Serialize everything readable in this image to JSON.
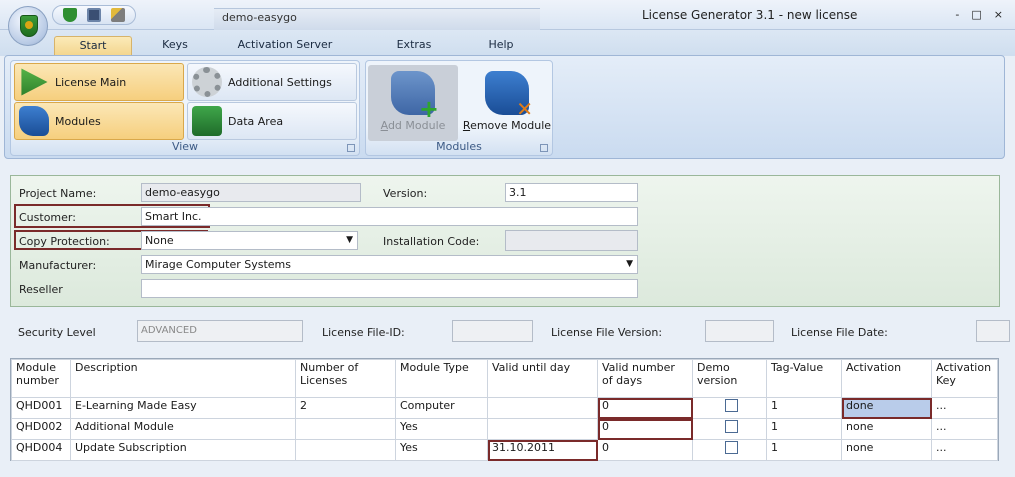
{
  "window": {
    "title": "License Generator 3.1 - new license",
    "context_tab": "demo-easygo",
    "controls": [
      "-",
      "□",
      "×"
    ]
  },
  "ribbon_tabs": [
    {
      "label": "Start",
      "active": true
    },
    {
      "label": "Keys",
      "active": false
    },
    {
      "label": "Activation Server",
      "active": false
    },
    {
      "label": "Extras",
      "active": false
    },
    {
      "label": "Help",
      "active": false
    }
  ],
  "ribbon": {
    "view_group": {
      "label": "View",
      "buttons": [
        {
          "label": "License Main",
          "icon": "play-icon",
          "selected": true
        },
        {
          "label": "Additional Settings",
          "icon": "gear-icon",
          "selected": false
        },
        {
          "label": "Modules",
          "icon": "puzzle-icon",
          "selected": true
        },
        {
          "label": "Data Area",
          "icon": "data-cube-icon",
          "selected": false
        }
      ]
    },
    "modules_group": {
      "label": "Modules",
      "add_prefix": "",
      "add_u": "A",
      "add_rest": "dd Module",
      "remove_u": "R",
      "remove_rest": "emove Module"
    }
  },
  "form": {
    "project_name": {
      "label": "Project Name:",
      "value": "demo-easygo"
    },
    "version": {
      "label": "Version:",
      "value": "3.1"
    },
    "customer": {
      "label": "Customer:",
      "value": "Smart Inc."
    },
    "copy_protection": {
      "label": "Copy Protection:",
      "value": "None"
    },
    "installation_code": {
      "label": "Installation Code:",
      "value": ""
    },
    "manufacturer": {
      "label": "Manufacturer:",
      "value": "Mirage Computer Systems"
    },
    "reseller": {
      "label": "Reseller",
      "value": ""
    }
  },
  "secondary": {
    "security_level": {
      "label": "Security Level",
      "value": "ADVANCED"
    },
    "license_file_id": {
      "label": "License File-ID:",
      "value": ""
    },
    "license_file_version": {
      "label": "License File Version:",
      "value": ""
    },
    "license_file_date": {
      "label": "License File Date:",
      "value": ""
    }
  },
  "grid": {
    "columns": [
      "Module number",
      "Description",
      "Number of Licenses",
      "Module Type",
      "Valid until day",
      "Valid number of days",
      "Demo version",
      "Tag-Value",
      "Activation",
      "Activation Key"
    ],
    "rows": [
      [
        "QHD001",
        "E-Learning Made Easy",
        "2",
        "Computer",
        "",
        "0",
        "",
        "1",
        "done",
        "..."
      ],
      [
        "QHD002",
        "Additional Module",
        "",
        "Yes",
        "",
        "0",
        "",
        "1",
        "none",
        "..."
      ],
      [
        "QHD004",
        "Update Subscription",
        "",
        "Yes",
        "31.10.2011",
        "0",
        "",
        "1",
        "none",
        "..."
      ]
    ]
  },
  "colors": {
    "highlight_border": "#7a2a2a",
    "selected_ribbon": "#f6cf7e",
    "activation_done_bg": "#b9ccea"
  }
}
